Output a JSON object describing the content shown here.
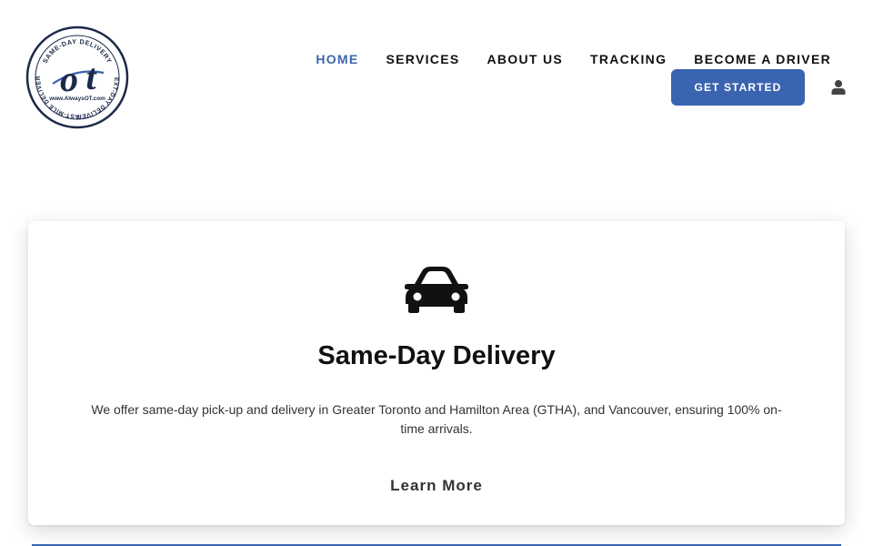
{
  "logo": {
    "ring_top_text": "SAME-DAY DELIVERY",
    "ring_right_text": "NEXT-DAY DELIVERY",
    "ring_left_text": "LAST-MILE DELIVERY",
    "mark_o": "o",
    "mark_t": "t",
    "website": "www.AlwaysOT.com"
  },
  "nav": {
    "items": [
      {
        "label": "HOME",
        "active": true
      },
      {
        "label": "SERVICES",
        "active": false
      },
      {
        "label": "ABOUT US",
        "active": false
      },
      {
        "label": "TRACKING",
        "active": false
      },
      {
        "label": "BECOME A DRIVER",
        "active": false
      }
    ],
    "cta_label": "GET STARTED",
    "user_icon": "user-icon"
  },
  "card": {
    "icon": "car-icon",
    "title": "Same-Day Delivery",
    "description": "We offer same-day pick-up and delivery in Greater Toronto and Hamilton Area (GTHA), and Vancouver, ensuring 100% on-time arrivals.",
    "link_label": "Learn More"
  },
  "colors": {
    "accent": "#3b64b0",
    "active_nav": "#3a67ab",
    "text": "#111111",
    "logo_dark": "#1b2a4a"
  }
}
